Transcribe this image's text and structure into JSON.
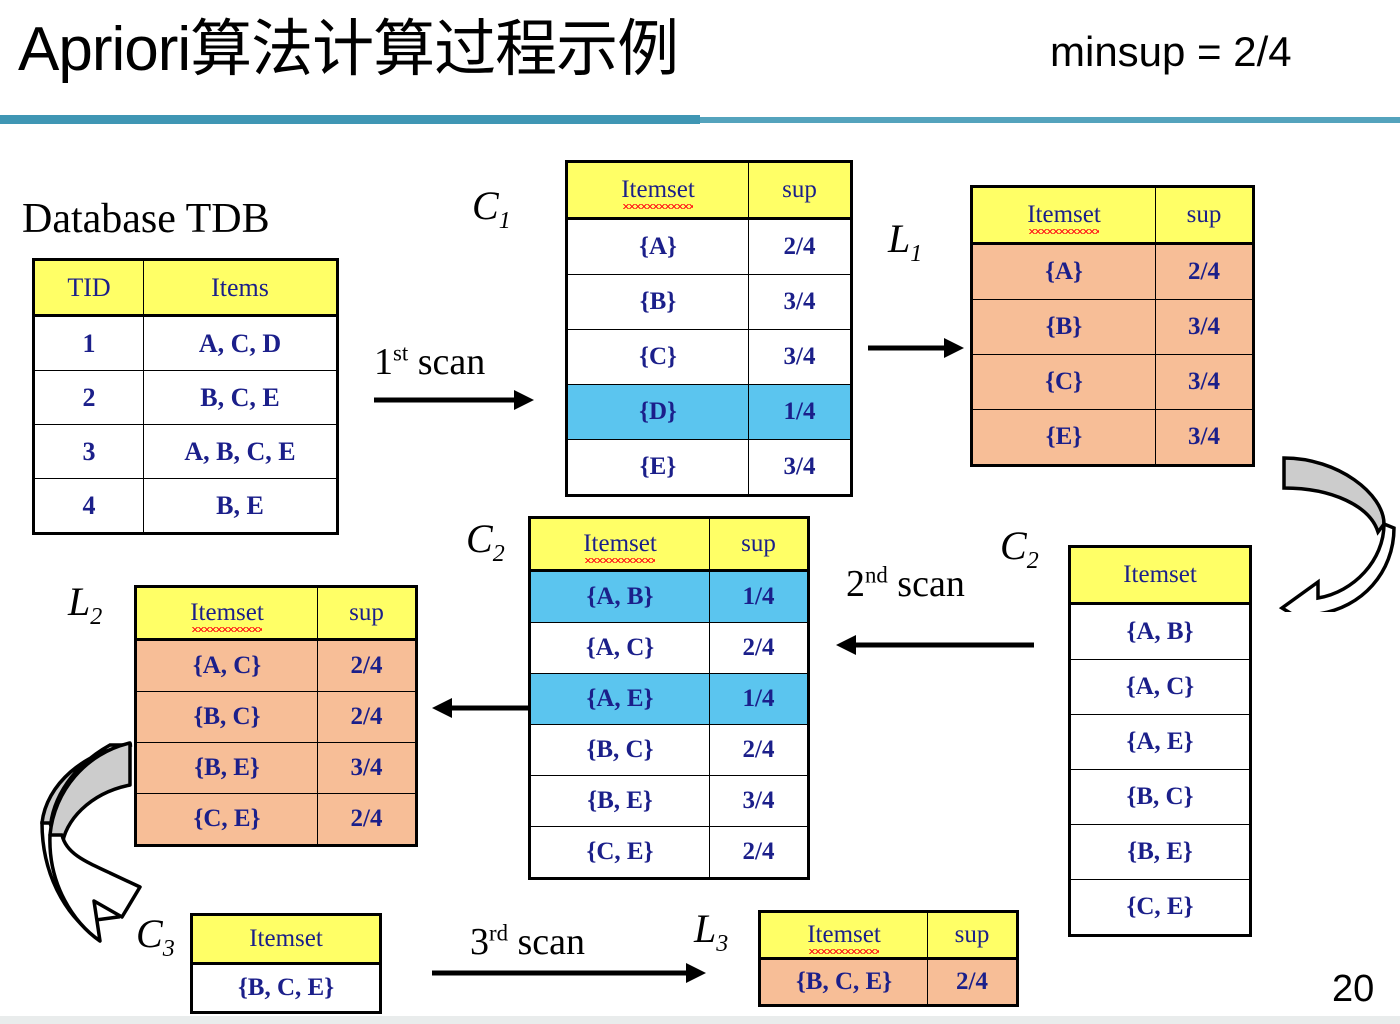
{
  "header": {
    "title": "Apriori算法计算过程示例",
    "minsup": "minsup = 2/4"
  },
  "footer": {
    "page_number": "20"
  },
  "database": {
    "title": "Database TDB",
    "columns": [
      "TID",
      "Items"
    ],
    "rows": [
      [
        "1",
        "A, C, D"
      ],
      [
        "2",
        "B, C, E"
      ],
      [
        "3",
        "A, B, C, E"
      ],
      [
        "4",
        "B, E"
      ]
    ]
  },
  "c1": {
    "label": "C",
    "subscript": "1",
    "columns": [
      "Itemset",
      "sup"
    ],
    "rows": [
      {
        "itemset": "{A}",
        "sup": "2/4",
        "highlight": "none"
      },
      {
        "itemset": "{B}",
        "sup": "3/4",
        "highlight": "none"
      },
      {
        "itemset": "{C}",
        "sup": "3/4",
        "highlight": "none"
      },
      {
        "itemset": "{D}",
        "sup": "1/4",
        "highlight": "blue"
      },
      {
        "itemset": "{E}",
        "sup": "3/4",
        "highlight": "none"
      }
    ]
  },
  "l1": {
    "label": "L",
    "subscript": "1",
    "columns": [
      "Itemset",
      "sup"
    ],
    "rows": [
      {
        "itemset": "{A}",
        "sup": "2/4",
        "highlight": "salmon"
      },
      {
        "itemset": "{B}",
        "sup": "3/4",
        "highlight": "salmon"
      },
      {
        "itemset": "{C}",
        "sup": "3/4",
        "highlight": "salmon"
      },
      {
        "itemset": "{E}",
        "sup": "3/4",
        "highlight": "salmon"
      }
    ]
  },
  "c2_counted": {
    "label": "C",
    "subscript": "2",
    "columns": [
      "Itemset",
      "sup"
    ],
    "rows": [
      {
        "itemset": "{A, B}",
        "sup": "1/4",
        "highlight": "blue"
      },
      {
        "itemset": "{A, C}",
        "sup": "2/4",
        "highlight": "none"
      },
      {
        "itemset": "{A, E}",
        "sup": "1/4",
        "highlight": "blue"
      },
      {
        "itemset": "{B, C}",
        "sup": "2/4",
        "highlight": "none"
      },
      {
        "itemset": "{B, E}",
        "sup": "3/4",
        "highlight": "none"
      },
      {
        "itemset": "{C, E}",
        "sup": "2/4",
        "highlight": "none"
      }
    ]
  },
  "c2_candidates": {
    "label": "C",
    "subscript": "2",
    "columns": [
      "Itemset"
    ],
    "rows": [
      {
        "itemset": "{A, B}"
      },
      {
        "itemset": "{A, C}"
      },
      {
        "itemset": "{A, E}"
      },
      {
        "itemset": "{B, C}"
      },
      {
        "itemset": "{B, E}"
      },
      {
        "itemset": "{C, E}"
      }
    ]
  },
  "l2": {
    "label": "L",
    "subscript": "2",
    "columns": [
      "Itemset",
      "sup"
    ],
    "rows": [
      {
        "itemset": "{A, C}",
        "sup": "2/4",
        "highlight": "salmon"
      },
      {
        "itemset": "{B, C}",
        "sup": "2/4",
        "highlight": "salmon"
      },
      {
        "itemset": "{B, E}",
        "sup": "3/4",
        "highlight": "salmon"
      },
      {
        "itemset": "{C, E}",
        "sup": "2/4",
        "highlight": "salmon"
      }
    ]
  },
  "c3": {
    "label": "C",
    "subscript": "3",
    "columns": [
      "Itemset"
    ],
    "rows": [
      {
        "itemset": "{B, C, E}"
      }
    ]
  },
  "l3": {
    "label": "L",
    "subscript": "3",
    "columns": [
      "Itemset",
      "sup"
    ],
    "rows": [
      {
        "itemset": "{B, C, E}",
        "sup": "2/4",
        "highlight": "salmon"
      }
    ]
  },
  "scans": {
    "first": {
      "ordinal": "1",
      "suffix": "st",
      "text": "scan"
    },
    "second": {
      "ordinal": "2",
      "suffix": "nd",
      "text": "scan"
    },
    "third": {
      "ordinal": "3",
      "suffix": "rd",
      "text": "scan"
    }
  },
  "colors": {
    "header_yellow": "#FFFF66",
    "pruned_blue": "#5BC5EF",
    "frequent_salmon": "#F7BE97",
    "text_navy": "#1B1F8A",
    "rule_teal": "#3F96B4",
    "curved_arrow_gray": "#CCCCCC"
  }
}
